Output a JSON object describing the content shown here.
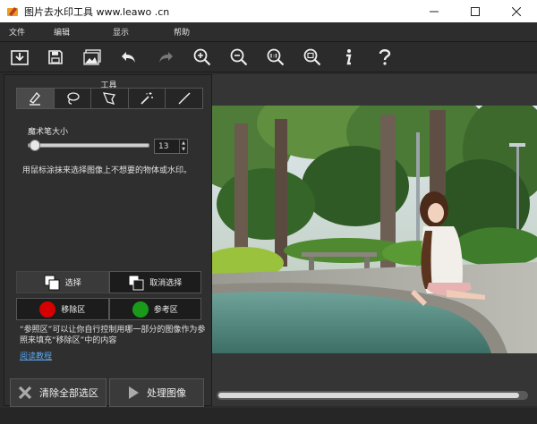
{
  "window": {
    "title": "图片去水印工具 www.leawo .cn"
  },
  "menu": [
    "文件",
    "编辑",
    "显示",
    "帮助"
  ],
  "toolbar": {
    "icons": [
      "open-icon",
      "save-icon",
      "image-icon",
      "undo-icon",
      "redo-icon",
      "zoom-in-icon",
      "zoom-out-icon",
      "actual-size-icon",
      "fit-icon",
      "info-icon",
      "help-icon"
    ]
  },
  "panel": {
    "tools_label": "工具",
    "brush_size_label": "魔术笔大小",
    "brush_size_value": "13",
    "brush_slider_fraction": 0.06,
    "hint": "用鼠标涂抹来选择图像上不想要的物体或水印。",
    "select_label": "选择",
    "deselect_label": "取消选择",
    "remove_area_label": "移除区",
    "reference_area_label": "参考区",
    "remove_color": "#d60000",
    "reference_color": "#1a9a1a",
    "note": "“参照区”可以让你自行控制用哪一部分的图像作为参照来填充“移除区”中的内容",
    "tutorial_link": "阅读教程",
    "clear_all_label": "清除全部选区",
    "process_label": "处理图像"
  }
}
